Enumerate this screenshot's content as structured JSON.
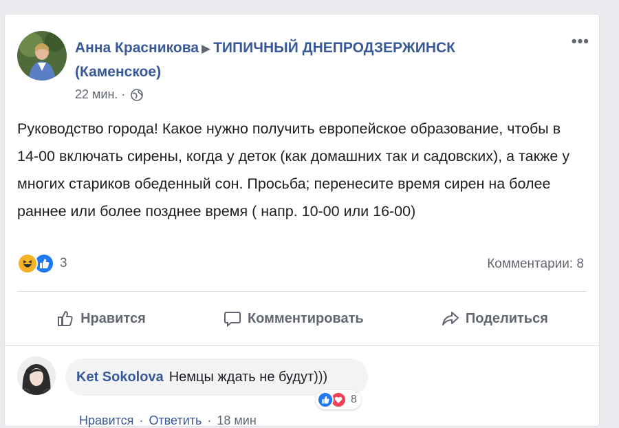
{
  "post": {
    "author": "Анна Красникова",
    "group": "ТИПИЧНЫЙ ДНЕПРОДЗЕРЖИНСК (Каменское)",
    "time": "22 мин. ·",
    "more": "•••",
    "text": "Руководство города! Какое нужно получить европейское образование, чтобы в 14-00 включать сирены, когда у деток (как домашних так и садовских), а также у многих стариков обеденный сон. Просьба; перенесите время сирен на более раннее или более позднее время ( напр. 10-00 или 16-00)",
    "reaction_count": "3",
    "comments_label": "Комментарии: 8"
  },
  "actions": {
    "like": "Нравится",
    "comment": "Комментировать",
    "share": "Поделиться"
  },
  "comment": {
    "author": "Ket Sokolova",
    "text": "Немцы ждать не будут)))",
    "reaction_count": "8",
    "like": "Нравится",
    "reply": "Ответить",
    "time": "18 мин"
  },
  "colors": {
    "link": "#385898",
    "like_blue": "#2078f4",
    "haha_yellow": "#f7b125",
    "love_red": "#f33e58"
  },
  "icons": [
    "globe-icon",
    "more-icon",
    "haha-icon",
    "like-reaction-icon",
    "love-reaction-icon",
    "thumbs-up-icon",
    "comment-icon",
    "share-icon"
  ]
}
